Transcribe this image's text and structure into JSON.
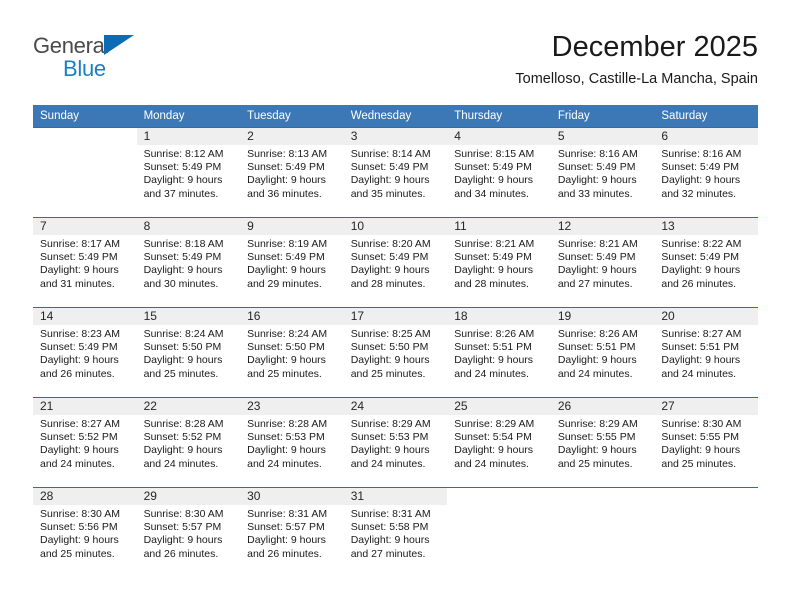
{
  "brand": {
    "word_one": "General",
    "word_two": "Blue",
    "triangle_color": "#0b6cb5",
    "blue_color": "#1b7fc4",
    "gray_color": "#4a4a4a"
  },
  "header": {
    "title": "December 2025",
    "subtitle": "Tomelloso, Castille-La Mancha, Spain"
  },
  "theme": {
    "header_bg": "#3b78b5",
    "header_text": "#ffffff",
    "daynum_bg": "#efefef",
    "row_rule": "#2f6da6"
  },
  "weekday_headers": [
    "Sunday",
    "Monday",
    "Tuesday",
    "Wednesday",
    "Thursday",
    "Friday",
    "Saturday"
  ],
  "weeks": [
    [
      {
        "day": "",
        "sunrise": "",
        "sunset": "",
        "daylight_1": "",
        "daylight_2": ""
      },
      {
        "day": "1",
        "sunrise": "Sunrise: 8:12 AM",
        "sunset": "Sunset: 5:49 PM",
        "daylight_1": "Daylight: 9 hours",
        "daylight_2": "and 37 minutes."
      },
      {
        "day": "2",
        "sunrise": "Sunrise: 8:13 AM",
        "sunset": "Sunset: 5:49 PM",
        "daylight_1": "Daylight: 9 hours",
        "daylight_2": "and 36 minutes."
      },
      {
        "day": "3",
        "sunrise": "Sunrise: 8:14 AM",
        "sunset": "Sunset: 5:49 PM",
        "daylight_1": "Daylight: 9 hours",
        "daylight_2": "and 35 minutes."
      },
      {
        "day": "4",
        "sunrise": "Sunrise: 8:15 AM",
        "sunset": "Sunset: 5:49 PM",
        "daylight_1": "Daylight: 9 hours",
        "daylight_2": "and 34 minutes."
      },
      {
        "day": "5",
        "sunrise": "Sunrise: 8:16 AM",
        "sunset": "Sunset: 5:49 PM",
        "daylight_1": "Daylight: 9 hours",
        "daylight_2": "and 33 minutes."
      },
      {
        "day": "6",
        "sunrise": "Sunrise: 8:16 AM",
        "sunset": "Sunset: 5:49 PM",
        "daylight_1": "Daylight: 9 hours",
        "daylight_2": "and 32 minutes."
      }
    ],
    [
      {
        "day": "7",
        "sunrise": "Sunrise: 8:17 AM",
        "sunset": "Sunset: 5:49 PM",
        "daylight_1": "Daylight: 9 hours",
        "daylight_2": "and 31 minutes."
      },
      {
        "day": "8",
        "sunrise": "Sunrise: 8:18 AM",
        "sunset": "Sunset: 5:49 PM",
        "daylight_1": "Daylight: 9 hours",
        "daylight_2": "and 30 minutes."
      },
      {
        "day": "9",
        "sunrise": "Sunrise: 8:19 AM",
        "sunset": "Sunset: 5:49 PM",
        "daylight_1": "Daylight: 9 hours",
        "daylight_2": "and 29 minutes."
      },
      {
        "day": "10",
        "sunrise": "Sunrise: 8:20 AM",
        "sunset": "Sunset: 5:49 PM",
        "daylight_1": "Daylight: 9 hours",
        "daylight_2": "and 28 minutes."
      },
      {
        "day": "11",
        "sunrise": "Sunrise: 8:21 AM",
        "sunset": "Sunset: 5:49 PM",
        "daylight_1": "Daylight: 9 hours",
        "daylight_2": "and 28 minutes."
      },
      {
        "day": "12",
        "sunrise": "Sunrise: 8:21 AM",
        "sunset": "Sunset: 5:49 PM",
        "daylight_1": "Daylight: 9 hours",
        "daylight_2": "and 27 minutes."
      },
      {
        "day": "13",
        "sunrise": "Sunrise: 8:22 AM",
        "sunset": "Sunset: 5:49 PM",
        "daylight_1": "Daylight: 9 hours",
        "daylight_2": "and 26 minutes."
      }
    ],
    [
      {
        "day": "14",
        "sunrise": "Sunrise: 8:23 AM",
        "sunset": "Sunset: 5:49 PM",
        "daylight_1": "Daylight: 9 hours",
        "daylight_2": "and 26 minutes."
      },
      {
        "day": "15",
        "sunrise": "Sunrise: 8:24 AM",
        "sunset": "Sunset: 5:50 PM",
        "daylight_1": "Daylight: 9 hours",
        "daylight_2": "and 25 minutes."
      },
      {
        "day": "16",
        "sunrise": "Sunrise: 8:24 AM",
        "sunset": "Sunset: 5:50 PM",
        "daylight_1": "Daylight: 9 hours",
        "daylight_2": "and 25 minutes."
      },
      {
        "day": "17",
        "sunrise": "Sunrise: 8:25 AM",
        "sunset": "Sunset: 5:50 PM",
        "daylight_1": "Daylight: 9 hours",
        "daylight_2": "and 25 minutes."
      },
      {
        "day": "18",
        "sunrise": "Sunrise: 8:26 AM",
        "sunset": "Sunset: 5:51 PM",
        "daylight_1": "Daylight: 9 hours",
        "daylight_2": "and 24 minutes."
      },
      {
        "day": "19",
        "sunrise": "Sunrise: 8:26 AM",
        "sunset": "Sunset: 5:51 PM",
        "daylight_1": "Daylight: 9 hours",
        "daylight_2": "and 24 minutes."
      },
      {
        "day": "20",
        "sunrise": "Sunrise: 8:27 AM",
        "sunset": "Sunset: 5:51 PM",
        "daylight_1": "Daylight: 9 hours",
        "daylight_2": "and 24 minutes."
      }
    ],
    [
      {
        "day": "21",
        "sunrise": "Sunrise: 8:27 AM",
        "sunset": "Sunset: 5:52 PM",
        "daylight_1": "Daylight: 9 hours",
        "daylight_2": "and 24 minutes."
      },
      {
        "day": "22",
        "sunrise": "Sunrise: 8:28 AM",
        "sunset": "Sunset: 5:52 PM",
        "daylight_1": "Daylight: 9 hours",
        "daylight_2": "and 24 minutes."
      },
      {
        "day": "23",
        "sunrise": "Sunrise: 8:28 AM",
        "sunset": "Sunset: 5:53 PM",
        "daylight_1": "Daylight: 9 hours",
        "daylight_2": "and 24 minutes."
      },
      {
        "day": "24",
        "sunrise": "Sunrise: 8:29 AM",
        "sunset": "Sunset: 5:53 PM",
        "daylight_1": "Daylight: 9 hours",
        "daylight_2": "and 24 minutes."
      },
      {
        "day": "25",
        "sunrise": "Sunrise: 8:29 AM",
        "sunset": "Sunset: 5:54 PM",
        "daylight_1": "Daylight: 9 hours",
        "daylight_2": "and 24 minutes."
      },
      {
        "day": "26",
        "sunrise": "Sunrise: 8:29 AM",
        "sunset": "Sunset: 5:55 PM",
        "daylight_1": "Daylight: 9 hours",
        "daylight_2": "and 25 minutes."
      },
      {
        "day": "27",
        "sunrise": "Sunrise: 8:30 AM",
        "sunset": "Sunset: 5:55 PM",
        "daylight_1": "Daylight: 9 hours",
        "daylight_2": "and 25 minutes."
      }
    ],
    [
      {
        "day": "28",
        "sunrise": "Sunrise: 8:30 AM",
        "sunset": "Sunset: 5:56 PM",
        "daylight_1": "Daylight: 9 hours",
        "daylight_2": "and 25 minutes."
      },
      {
        "day": "29",
        "sunrise": "Sunrise: 8:30 AM",
        "sunset": "Sunset: 5:57 PM",
        "daylight_1": "Daylight: 9 hours",
        "daylight_2": "and 26 minutes."
      },
      {
        "day": "30",
        "sunrise": "Sunrise: 8:31 AM",
        "sunset": "Sunset: 5:57 PM",
        "daylight_1": "Daylight: 9 hours",
        "daylight_2": "and 26 minutes."
      },
      {
        "day": "31",
        "sunrise": "Sunrise: 8:31 AM",
        "sunset": "Sunset: 5:58 PM",
        "daylight_1": "Daylight: 9 hours",
        "daylight_2": "and 27 minutes."
      },
      {
        "day": "",
        "sunrise": "",
        "sunset": "",
        "daylight_1": "",
        "daylight_2": ""
      },
      {
        "day": "",
        "sunrise": "",
        "sunset": "",
        "daylight_1": "",
        "daylight_2": ""
      },
      {
        "day": "",
        "sunrise": "",
        "sunset": "",
        "daylight_1": "",
        "daylight_2": ""
      }
    ]
  ]
}
